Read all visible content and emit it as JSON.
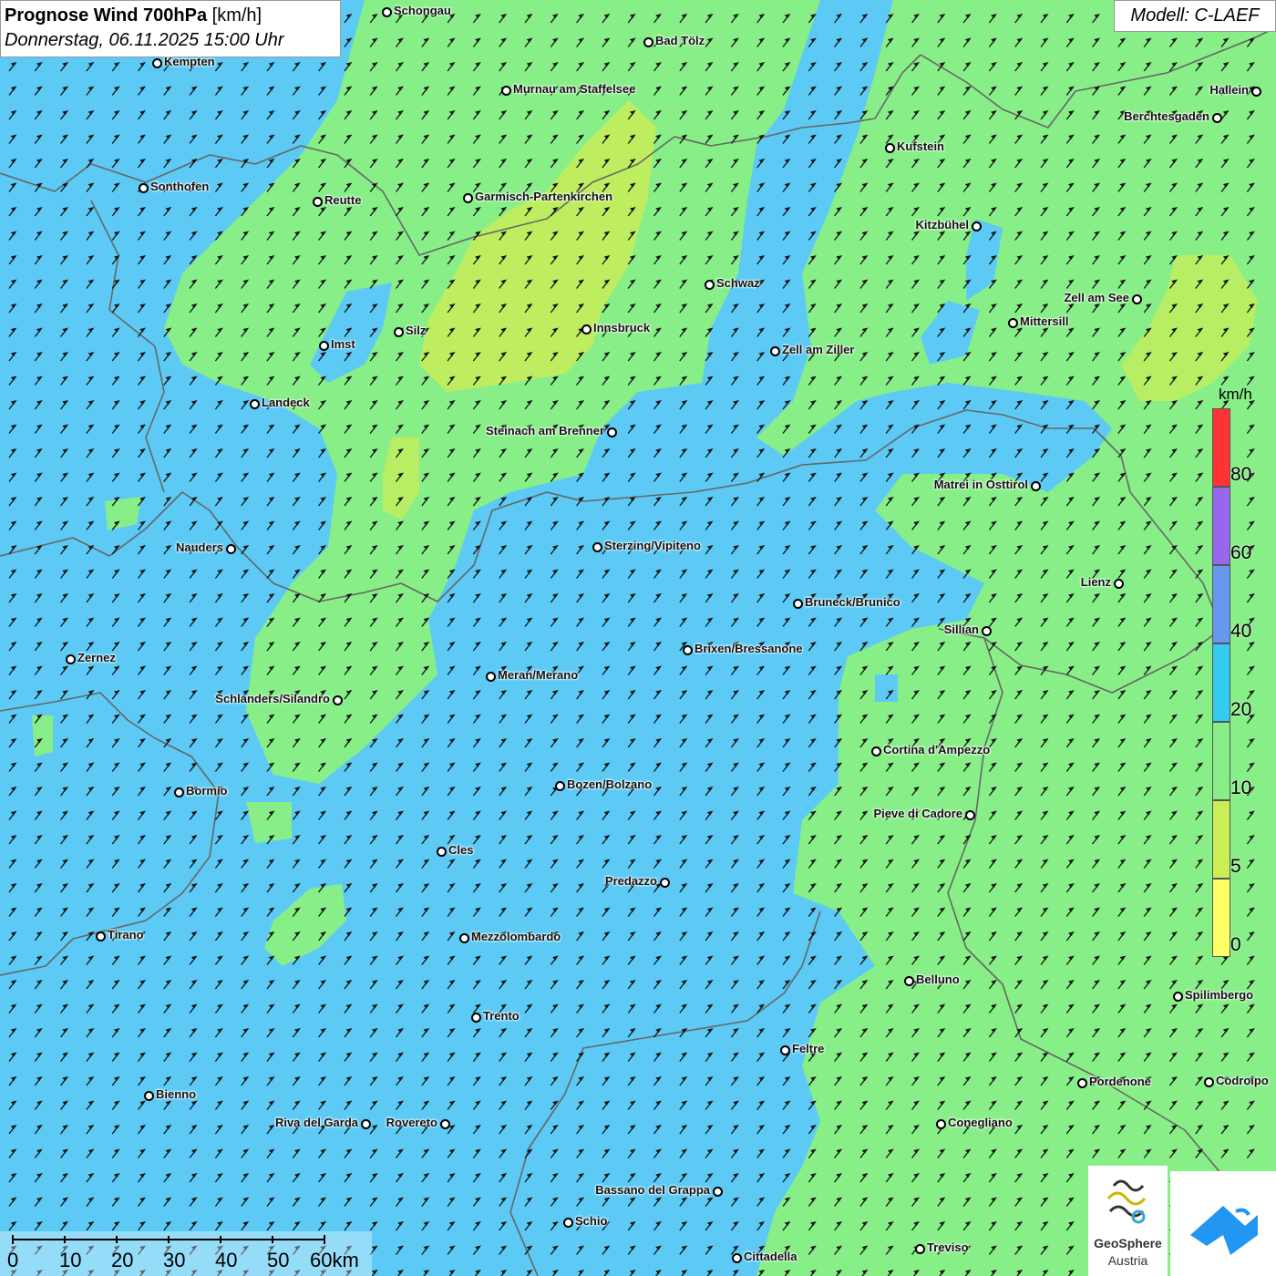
{
  "header": {
    "title_bold": "Prognose Wind 700hPa",
    "title_unit": "[km/h]",
    "subtitle": "Donnerstag, 06.11.2025 15:00 Uhr"
  },
  "model_label": "Modell: C-LAEF",
  "legend": {
    "unit": "km/h",
    "levels": [
      {
        "label": "0",
        "color": "#ffff66"
      },
      {
        "label": "5",
        "color": "#ccee55"
      },
      {
        "label": "10",
        "color": "#88ee88"
      },
      {
        "label": "20",
        "color": "#33ccf0"
      },
      {
        "label": "40",
        "color": "#6699ee"
      },
      {
        "label": "60",
        "color": "#9966ee"
      },
      {
        "label": "80",
        "color": "#ff3333"
      }
    ]
  },
  "scale_bar": {
    "labels": [
      "0",
      "10",
      "20",
      "30",
      "40",
      "50",
      "60km"
    ]
  },
  "logos": {
    "geosphere_name": "GeoSphere",
    "geosphere_sub": "Austria"
  },
  "colors": {
    "wind_0_5": "#ffff66",
    "wind_5_10": "#ccee55",
    "wind_10_20": "#88ee88",
    "wind_20_40": "#5ccaf5",
    "arrow": "#111111",
    "border": "#666666"
  },
  "cities": [
    {
      "name": "Schongau",
      "side": "right"
    },
    {
      "name": "Bad Tölz",
      "side": "right"
    },
    {
      "name": "Kempten",
      "side": "right"
    },
    {
      "name": "Murnau am Staffelsee",
      "side": "right"
    },
    {
      "name": "Hallein",
      "side": "left"
    },
    {
      "name": "Berchtesgaden",
      "side": "left"
    },
    {
      "name": "Kufstein",
      "side": "right"
    },
    {
      "name": "Sonthofen",
      "side": "right"
    },
    {
      "name": "Reutte",
      "side": "right"
    },
    {
      "name": "Garmisch-Partenkirchen",
      "side": "right"
    },
    {
      "name": "Kitzbühel",
      "side": "left"
    },
    {
      "name": "Schwaz",
      "side": "right"
    },
    {
      "name": "Zell am See",
      "side": "left"
    },
    {
      "name": "Mittersill",
      "side": "right"
    },
    {
      "name": "Silz",
      "side": "right"
    },
    {
      "name": "Innsbruck",
      "side": "right"
    },
    {
      "name": "Imst",
      "side": "right"
    },
    {
      "name": "Zell am Ziller",
      "side": "right"
    },
    {
      "name": "Landeck",
      "side": "right"
    },
    {
      "name": "Steinach am Brenner",
      "side": "left"
    },
    {
      "name": "Matrei in Osttirol",
      "side": "left"
    },
    {
      "name": "Nauders",
      "side": "left"
    },
    {
      "name": "Sterzing/Vipiteno",
      "side": "right"
    },
    {
      "name": "Lienz",
      "side": "left"
    },
    {
      "name": "Bruneck/Brunico",
      "side": "right"
    },
    {
      "name": "Sillian",
      "side": "left"
    },
    {
      "name": "Brixen/Bressanone",
      "side": "right"
    },
    {
      "name": "Zernez",
      "side": "right"
    },
    {
      "name": "Meran/Merano",
      "side": "right"
    },
    {
      "name": "Schlanders/Silandro",
      "side": "left"
    },
    {
      "name": "Cortina d'Ampezzo",
      "side": "right"
    },
    {
      "name": "Bozen/Bolzano",
      "side": "right"
    },
    {
      "name": "Bormio",
      "side": "right"
    },
    {
      "name": "Pieve di Cadore",
      "side": "left"
    },
    {
      "name": "Cles",
      "side": "right"
    },
    {
      "name": "Predazzo",
      "side": "left"
    },
    {
      "name": "Tirano",
      "side": "right"
    },
    {
      "name": "Mezzolombardo",
      "side": "right"
    },
    {
      "name": "Belluno",
      "side": "right"
    },
    {
      "name": "Spilimbergo",
      "side": "right"
    },
    {
      "name": "Trento",
      "side": "right"
    },
    {
      "name": "Feltre",
      "side": "right"
    },
    {
      "name": "Pordenone",
      "side": "right"
    },
    {
      "name": "Codroipo",
      "side": "right"
    },
    {
      "name": "Bienno",
      "side": "right"
    },
    {
      "name": "Riva del Garda",
      "side": "left"
    },
    {
      "name": "Rovereto",
      "side": "left"
    },
    {
      "name": "Conegliano",
      "side": "right"
    },
    {
      "name": "Bassano del Grappa",
      "side": "left"
    },
    {
      "name": "Schio",
      "side": "right"
    },
    {
      "name": "Treviso",
      "side": "right"
    },
    {
      "name": "Cittadella",
      "side": "right"
    }
  ]
}
